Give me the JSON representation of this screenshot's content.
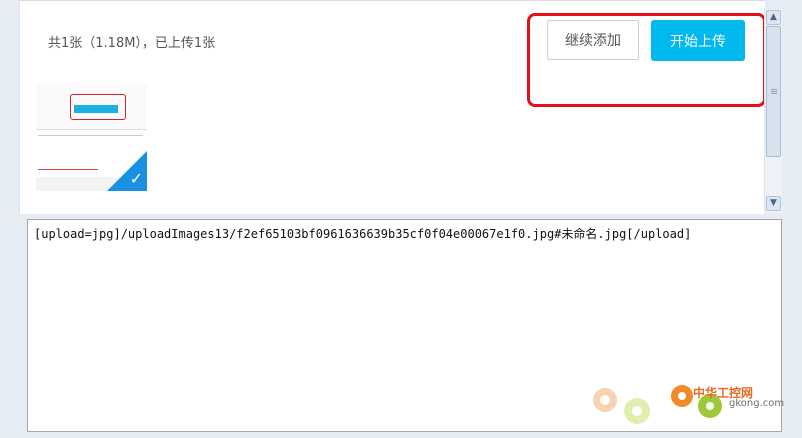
{
  "upload": {
    "status_text": "共1张（1.18M），已上传1张",
    "add_more_label": "继续添加",
    "start_upload_label": "开始上传",
    "thumbnail_uploaded": true
  },
  "editor": {
    "content": "[upload=jpg]/uploadImages13/f2ef65103bf0961636639b35cf0f04e00067e1f0.jpg#未命名.jpg[/upload]"
  },
  "scrollbar": {
    "up_arrow": "▲",
    "down_arrow": "▼"
  },
  "watermark": {
    "site_name": "中华工控网",
    "domain": "gkong.com"
  },
  "colors": {
    "primary_button": "#00b7ee",
    "highlight": "#e1101a",
    "check_badge": "#1a90e2"
  }
}
